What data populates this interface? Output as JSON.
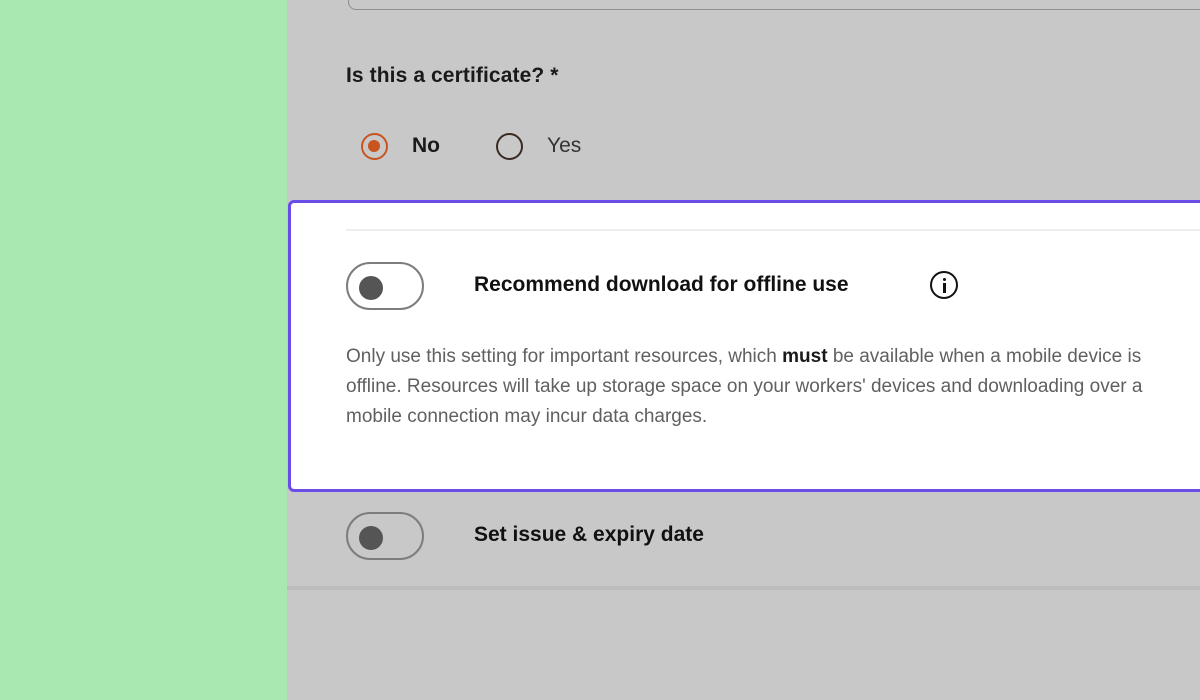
{
  "form": {
    "certificate_question": "Is this a certificate? *",
    "certificate_options": [
      {
        "label": "No",
        "selected": true
      },
      {
        "label": "Yes",
        "selected": false
      }
    ],
    "offline_toggle": {
      "label": "Recommend download for offline use",
      "enabled": false,
      "icon": "info-icon",
      "description_before": "Only use this setting for important resources, which ",
      "description_emphasis": "must",
      "description_after": " be available when a mobile device is offline. Resources will take up storage space on your workers' devices and downloading over a mobile connection may incur data charges."
    },
    "expiry_toggle": {
      "label": "Set issue & expiry date",
      "enabled": false
    }
  },
  "colors": {
    "accent_radio": "#c9541e",
    "highlight_border": "#6a4ce8",
    "left_panel": "#a9e8b0",
    "overlay": "#c8c8c8"
  }
}
